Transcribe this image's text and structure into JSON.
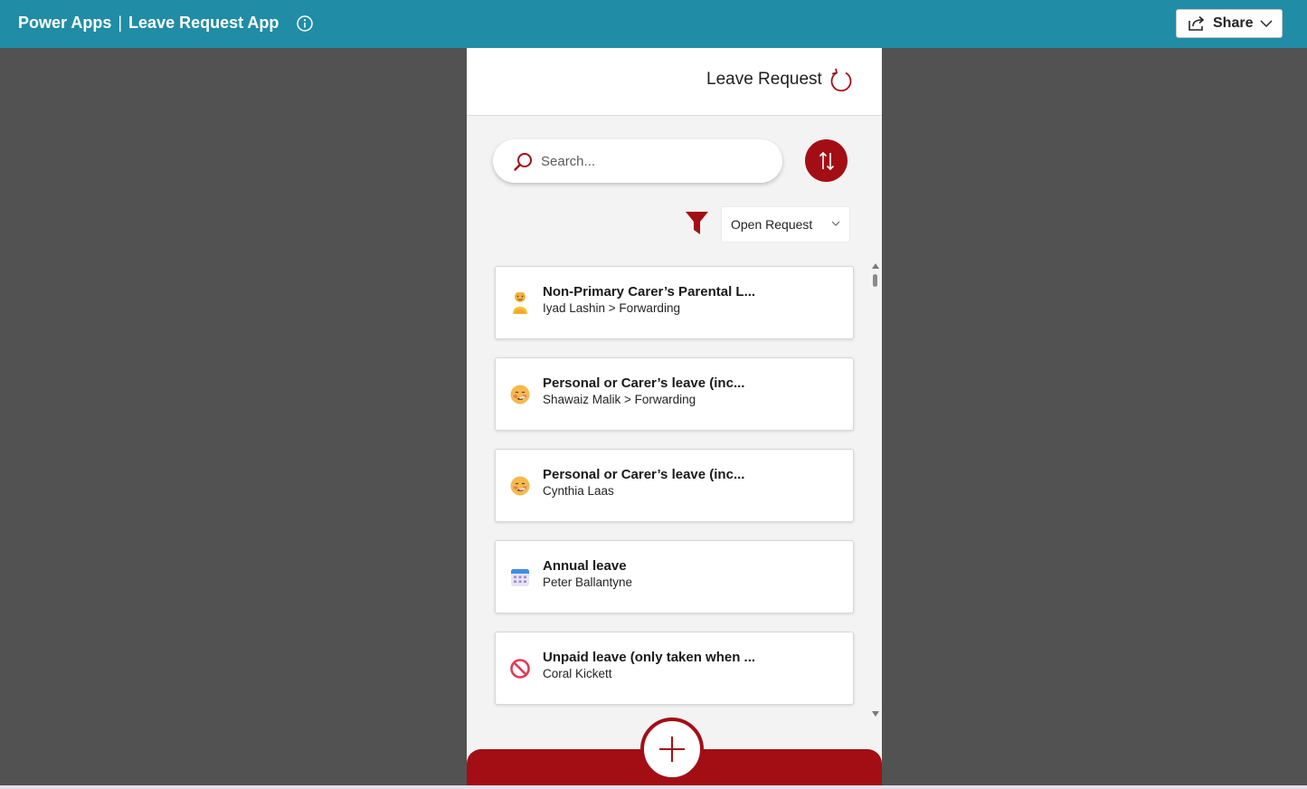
{
  "topbar": {
    "app_name": "Power Apps",
    "separator": "|",
    "app_title": "Leave Request App",
    "info_icon": "info-circle-icon",
    "share_label": "Share",
    "share_icon": "share-icon",
    "share_chevron_icon": "chevron-down-icon"
  },
  "phone": {
    "header_title": "Leave Request",
    "refresh_icon": "refresh-icon",
    "search": {
      "placeholder": "Search...",
      "icon": "search-icon"
    },
    "sort_icon": "sort-arrows-icon",
    "filter": {
      "icon": "filter-funnel-icon",
      "selected": "Open Request"
    },
    "requests": [
      {
        "icon": "family-emoji-icon",
        "title": "Non-Primary Carer’s Parental L...",
        "subtitle": "Iyad Lashin > Forwarding"
      },
      {
        "icon": "sick-face-emoji-icon",
        "title": "Personal or Carer’s leave (inc...",
        "subtitle": "Shawaiz Malik > Forwarding"
      },
      {
        "icon": "sick-face-emoji-icon",
        "title": "Personal or Carer’s leave (inc...",
        "subtitle": "Cynthia Laas"
      },
      {
        "icon": "calendar-icon",
        "title": "Annual leave",
        "subtitle": "Peter Ballantyne"
      },
      {
        "icon": "prohibited-icon",
        "title": "Unpaid leave (only taken when ...",
        "subtitle": "Coral Kickett"
      }
    ],
    "add_icon": "plus-icon"
  },
  "colors": {
    "topbar": "#218ca5",
    "accent": "#a30e15",
    "backdrop": "#525252",
    "canvas": "#f3f3f3"
  }
}
